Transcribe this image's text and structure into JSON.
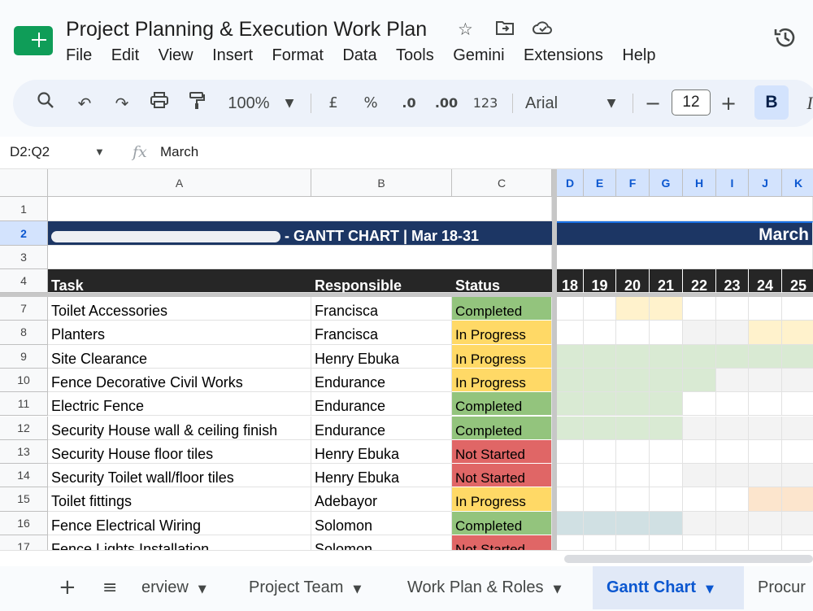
{
  "app": {
    "title": "Project Planning & Execution Work Plan",
    "menu": [
      "File",
      "Edit",
      "View",
      "Insert",
      "Format",
      "Data",
      "Tools",
      "Gemini",
      "Extensions",
      "Help"
    ]
  },
  "toolbar": {
    "zoom": "100%",
    "currency": "£",
    "percent": "%",
    "decrease_decimal": ".0",
    "increase_decimal": ".00",
    "number_format": "123",
    "font": "Arial",
    "font_size": "12",
    "bold": "B",
    "italic": "I"
  },
  "formula_bar": {
    "name_box": "D2:Q2",
    "fx": "fx",
    "value": "March"
  },
  "columns": [
    "A",
    "B",
    "C",
    "D",
    "E",
    "F",
    "G",
    "H",
    "I",
    "J",
    "K"
  ],
  "row_numbers": [
    "1",
    "2",
    "3",
    "4",
    "7",
    "8",
    "9",
    "10",
    "11",
    "12",
    "13",
    "14",
    "15",
    "16",
    "17"
  ],
  "sheet": {
    "title_suffix": " - GANTT CHART  |  Mar 18-31",
    "month": "March",
    "headers": {
      "task": "Task",
      "responsible": "Responsible",
      "status": "Status"
    },
    "days": [
      "18",
      "19",
      "20",
      "21",
      "22",
      "23",
      "24",
      "25"
    ],
    "rows": [
      {
        "task": "Toilet Accessories",
        "responsible": "Francisca",
        "status": "Completed"
      },
      {
        "task": "Planters",
        "responsible": "Francisca",
        "status": "In Progress"
      },
      {
        "task": "Site Clearance",
        "responsible": "Henry Ebuka",
        "status": "In Progress"
      },
      {
        "task": "Fence Decorative Civil Works",
        "responsible": "Endurance",
        "status": "In Progress"
      },
      {
        "task": "Electric Fence",
        "responsible": "Endurance",
        "status": "Completed"
      },
      {
        "task": "Security House wall & ceiling finish",
        "responsible": "Endurance",
        "status": "Completed"
      },
      {
        "task": "Security House floor tiles",
        "responsible": "Henry Ebuka",
        "status": "Not Started"
      },
      {
        "task": "Security Toilet wall/floor tiles",
        "responsible": "Henry Ebuka",
        "status": "Not Started"
      },
      {
        "task": "Toilet fittings",
        "responsible": "Adebayor",
        "status": "In Progress"
      },
      {
        "task": "Fence Electrical Wiring",
        "responsible": "Solomon",
        "status": "Completed"
      },
      {
        "task": "Fence Lights Installation",
        "responsible": "Solomon",
        "status": "Not Started"
      }
    ],
    "gantt": [
      [
        0,
        0,
        1,
        1,
        0,
        0,
        0,
        0
      ],
      [
        0,
        0,
        0,
        0,
        0,
        0,
        1,
        1
      ],
      [
        1,
        1,
        1,
        1,
        1,
        1,
        1,
        1
      ],
      [
        1,
        1,
        1,
        1,
        1,
        0,
        0,
        0
      ],
      [
        1,
        1,
        1,
        1,
        0,
        0,
        0,
        0
      ],
      [
        1,
        1,
        1,
        1,
        0,
        0,
        0,
        0
      ],
      [
        0,
        0,
        0,
        0,
        0,
        0,
        0,
        0
      ],
      [
        0,
        0,
        0,
        0,
        0,
        0,
        0,
        0
      ],
      [
        0,
        0,
        0,
        0,
        0,
        0,
        1,
        1
      ],
      [
        1,
        1,
        1,
        1,
        0,
        0,
        0,
        0
      ],
      [
        0,
        0,
        0,
        0,
        0,
        0,
        0,
        0
      ]
    ]
  },
  "colors": {
    "completed": "#93c47d",
    "in_progress": "#ffd966",
    "not_started": "#e06666",
    "header_navy": "#1c3664",
    "header_black": "#262626",
    "bar_yellow": "#fff2cc",
    "bar_green": "#d9ead3",
    "bar_orange": "#fce5cd",
    "bar_blue": "#d0e0e3"
  },
  "sheet_tabs": [
    "erview",
    "Project Team",
    "Work Plan & Roles",
    "Gantt Chart",
    "Procur"
  ]
}
